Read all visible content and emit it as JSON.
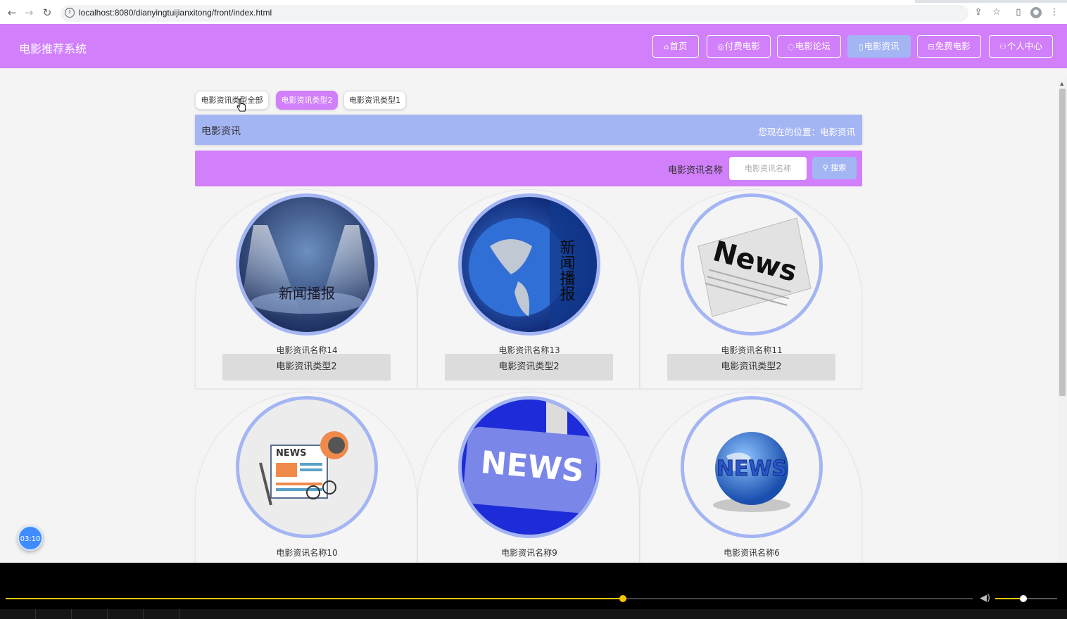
{
  "browser": {
    "url": "localhost:8080/dianyingtuijianxitong/front/index.html"
  },
  "header": {
    "site_title": "电影推荐系统",
    "nav": [
      {
        "label": "首页",
        "icon": "home-icon"
      },
      {
        "label": "付费电影",
        "icon": "pay-icon"
      },
      {
        "label": "电影论坛",
        "icon": "forum-icon"
      },
      {
        "label": "电影资讯",
        "icon": "news-icon",
        "active": true
      },
      {
        "label": "免费电影",
        "icon": "free-icon"
      },
      {
        "label": "个人中心",
        "icon": "user-icon"
      }
    ]
  },
  "filters": {
    "chips": [
      {
        "label": "电影资讯类型全部"
      },
      {
        "label": "电影资讯类型2",
        "active": true
      },
      {
        "label": "电影资讯类型1"
      }
    ]
  },
  "breadcrumb": {
    "title": "电影资讯",
    "path": "您现在的位置：电影资讯"
  },
  "search": {
    "label": "电影资讯名称",
    "placeholder": "电影资讯名称",
    "button": "搜索"
  },
  "cards": [
    {
      "name": "电影资讯名称14",
      "type": "电影资讯类型2",
      "image_text": "新闻播报"
    },
    {
      "name": "电影资讯名称13",
      "type": "电影资讯类型2",
      "image_text": "新闻播报"
    },
    {
      "name": "电影资讯名称11",
      "type": "电影资讯类型2",
      "image_text": "News"
    },
    {
      "name": "电影资讯名称10",
      "type": "",
      "image_text": "NEWS"
    },
    {
      "name": "电影资讯名称9",
      "type": "",
      "image_text": "NEWS"
    },
    {
      "name": "电影资讯名称6",
      "type": "",
      "image_text": "NEWS"
    }
  ],
  "timer": {
    "label": "03:10"
  },
  "player": {
    "progress": 0.638,
    "volume": 0.45
  },
  "colors": {
    "header": "#d17ffb",
    "accent_blue": "#a4b5f3",
    "timer_blue": "#3f8cff",
    "seek_yellow": "#f7c500"
  }
}
